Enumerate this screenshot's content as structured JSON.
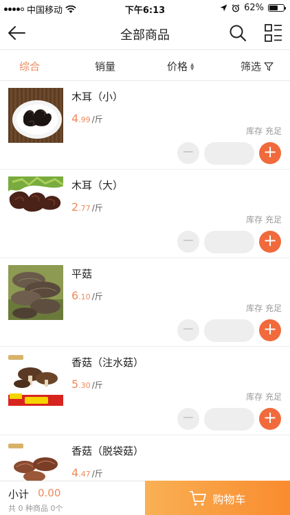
{
  "status_bar": {
    "carrier": "中国移动",
    "time": "下午6:13",
    "battery": "62%",
    "battery_level": 0.62
  },
  "header": {
    "title": "全部商品",
    "icons": [
      "back-arrow-icon",
      "search-icon",
      "grid-list-icon"
    ]
  },
  "sort_bar": {
    "options": [
      {
        "label": "综合",
        "active": true
      },
      {
        "label": "销量",
        "active": false
      },
      {
        "label": "价格",
        "active": false
      },
      {
        "label": "筛选",
        "active": false
      }
    ]
  },
  "products": [
    {
      "name": "木耳（小）",
      "price_int": "4",
      "price_dec": ".99",
      "unit": "/斤",
      "stock": "库存 充足",
      "minus": "−",
      "plus": "+"
    },
    {
      "name": "木耳（大）",
      "price_int": "2",
      "price_dec": ".77",
      "unit": "/斤",
      "stock": "库存 充足",
      "minus": "−",
      "plus": "+"
    },
    {
      "name": "平菇",
      "price_int": "6",
      "price_dec": ".10",
      "unit": "/斤",
      "stock": "库存 充足",
      "minus": "−",
      "plus": "+"
    },
    {
      "name": "香菇（注水菇）",
      "price_int": "5",
      "price_dec": ".30",
      "unit": "/斤",
      "stock": "库存 充足",
      "minus": "−",
      "plus": "+"
    },
    {
      "name": "香菇（脱袋菇）",
      "price_int": "4",
      "price_dec": ".47",
      "unit": "/斤",
      "stock": "",
      "minus": "",
      "plus": ""
    }
  ],
  "bottom_bar": {
    "subtotal_label": "小计",
    "amount": "0.00",
    "count_text": "共 0 种商品 0个",
    "cart_label": "购物车"
  },
  "colors": {
    "accent": "#f0885a",
    "plus_button": "#f06a3c",
    "cart_gradient_start": "#f9b054",
    "cart_gradient_end": "#f98b2e"
  }
}
